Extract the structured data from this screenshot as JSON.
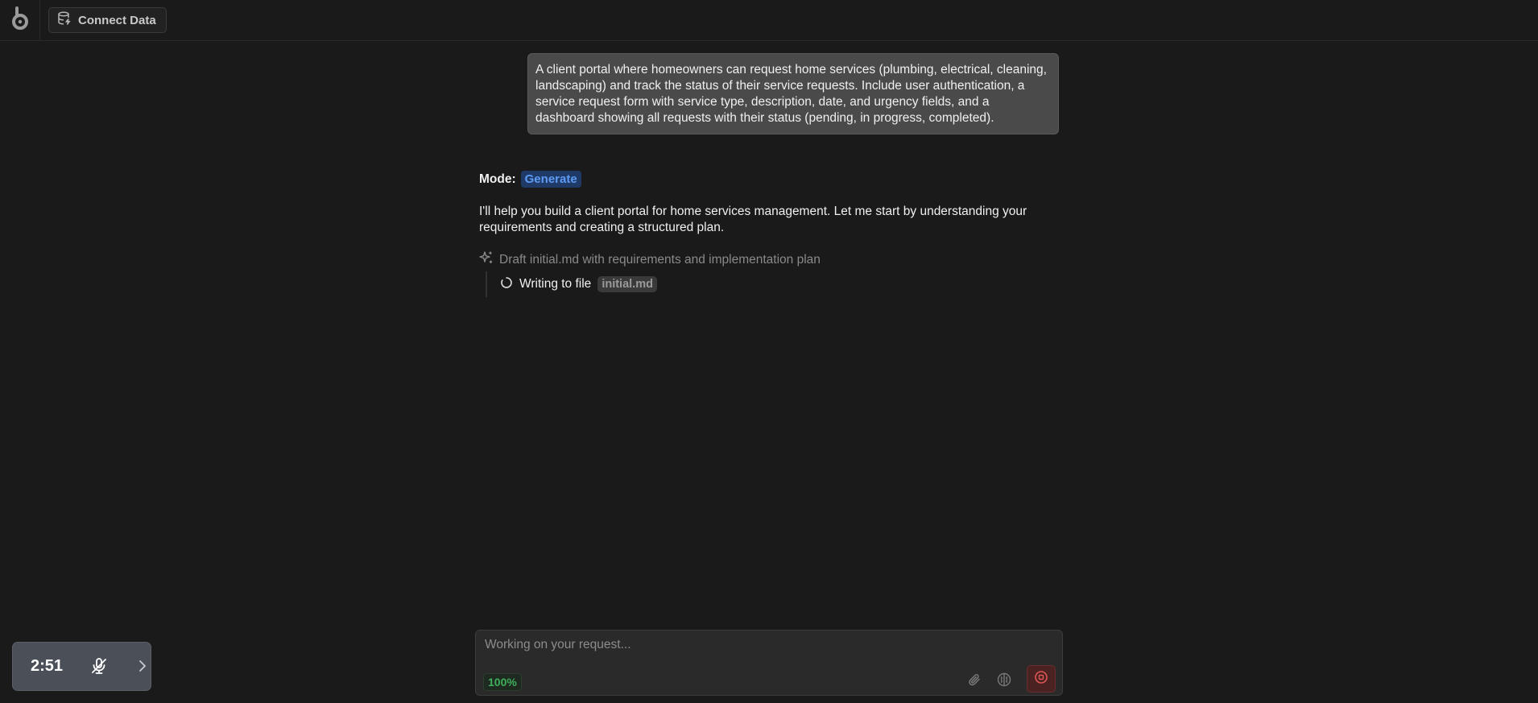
{
  "header": {
    "connect_label": "Connect Data",
    "logo_icon": "app-logo-icon",
    "connect_icon": "database-icon"
  },
  "chat": {
    "user_message": "A client portal where homeowners can request home services (plumbing, electrical, cleaning, landscaping) and track the status of their service requests. Include user authentication, a service request form with service type, description, date, and urgency fields, and a dashboard showing all requests with their status (pending, in progress, completed).",
    "mode_label": "Mode:",
    "mode_value": "Generate",
    "assistant_message": "I'll help you build a client portal for home services management. Let me start by understanding your requirements and creating a structured plan.",
    "task": {
      "label": "Draft initial.md with requirements and implementation plan",
      "icon": "sparkle-icon"
    },
    "subtask": {
      "label": "Writing to file",
      "file": "initial.md",
      "icon": "spinner-icon"
    }
  },
  "composer": {
    "placeholder": "Working on your request...",
    "progress_percent": "100%",
    "tools": [
      "paperclip-icon",
      "brain-icon",
      "stop-icon"
    ]
  },
  "recorder": {
    "time": "2:51",
    "mic_icon": "mic-off-icon",
    "expand_icon": "chevron-right-icon"
  },
  "colors": {
    "background": "#1a1a1a",
    "mode_badge": "#5e9bf5",
    "progress": "#3fae5a",
    "stop": "#e05555"
  }
}
